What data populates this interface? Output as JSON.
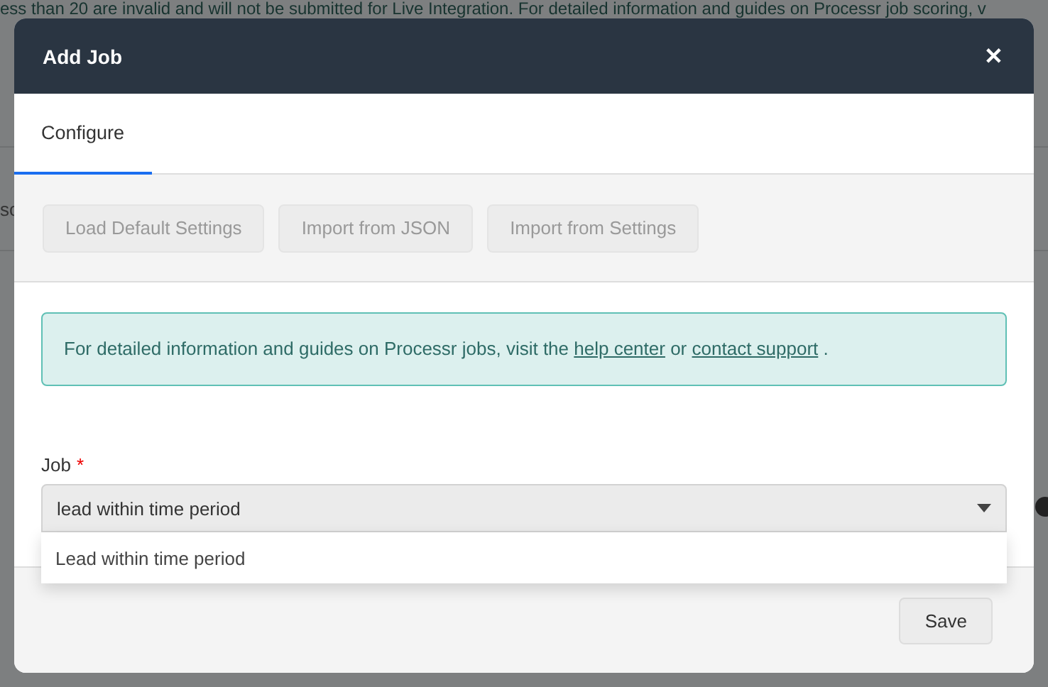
{
  "background": {
    "notice": "ess than 20 are invalid and will not be submitted for Live Integration. For detailed information and guides on Processr job scoring, v",
    "fragment": "sc"
  },
  "dialog": {
    "title": "Add Job",
    "close": "✕"
  },
  "tabs": [
    {
      "label": "Configure",
      "selected": true
    }
  ],
  "toolbar": [
    {
      "label": "Load Default Settings",
      "disabled": true
    },
    {
      "label": "Import from JSON",
      "disabled": true
    },
    {
      "label": "Import from Settings",
      "disabled": true
    }
  ],
  "alert": {
    "before": "For detailed information and guides on Processr jobs, visit the ",
    "link1": "help center",
    "middle": " or ",
    "link2": "contact support",
    "after": " ."
  },
  "job_field": {
    "label": "Job",
    "required_mark": "*",
    "value": "lead within time period",
    "expanded": true,
    "options": [
      {
        "label": "Lead within time period",
        "selected": false
      }
    ]
  },
  "footer": {
    "save": "Save"
  }
}
